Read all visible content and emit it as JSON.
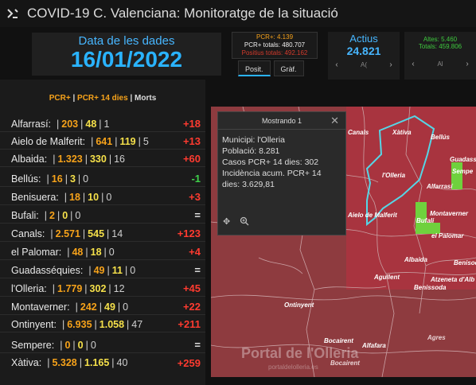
{
  "header": {
    "title": "COVID-19 C. Valenciana: Monitoratge de la situació",
    "logo_icon": "dashboard-logo-icon"
  },
  "date_box": {
    "label": "Data de les dades",
    "value": "16/01/2022"
  },
  "pcr_box": {
    "line1": "PCR+: 4.139",
    "line2": "PCR+ totals: 480.707",
    "line3": "Positius totals: 492.162"
  },
  "tabs": [
    {
      "label": "Posit.",
      "active": true
    },
    {
      "label": "Gràf.",
      "active": false
    }
  ],
  "actius": {
    "label": "Actius",
    "value": "24.821",
    "pager": "A("
  },
  "altes": {
    "line1": "Altes: 5.460",
    "line2": "Totals: 459.806",
    "pager": "Al"
  },
  "list": {
    "legend": {
      "a": "PCR+",
      "b": "PCR+ 14 dies",
      "c": "Morts",
      "sep": " | "
    },
    "rows": [
      {
        "name": "Alfarrasí:",
        "pcr": "203",
        "pcr14": "48",
        "morts": "1",
        "delta": "+18",
        "dir": "up"
      },
      {
        "name": "Aielo de Malferit:",
        "pcr": "641",
        "pcr14": "119",
        "morts": "5",
        "delta": "+13",
        "dir": "up"
      },
      {
        "name": "Albaida:",
        "pcr": "1.323",
        "pcr14": "330",
        "morts": "16",
        "delta": "+60",
        "dir": "up"
      },
      {
        "name": "Bellús:",
        "pcr": "16",
        "pcr14": "3",
        "morts": "0",
        "delta": "-1",
        "dir": "down"
      },
      {
        "name": "Benisuera:",
        "pcr": "18",
        "pcr14": "10",
        "morts": "0",
        "delta": "+3",
        "dir": "up"
      },
      {
        "name": "Bufali:",
        "pcr": "2",
        "pcr14": "0",
        "morts": "0",
        "delta": "=",
        "dir": "eq"
      },
      {
        "name": "Canals:",
        "pcr": "2.571",
        "pcr14": "545",
        "morts": "14",
        "delta": "+123",
        "dir": "up"
      },
      {
        "name": "el Palomar:",
        "pcr": "48",
        "pcr14": "18",
        "morts": "0",
        "delta": "+4",
        "dir": "up"
      },
      {
        "name": "Guadasséquies:",
        "pcr": "49",
        "pcr14": "11",
        "morts": "0",
        "delta": "=",
        "dir": "eq"
      },
      {
        "name": "l'Olleria:",
        "pcr": "1.779",
        "pcr14": "302",
        "morts": "12",
        "delta": "+45",
        "dir": "up"
      },
      {
        "name": "Montaverner:",
        "pcr": "242",
        "pcr14": "49",
        "morts": "0",
        "delta": "+22",
        "dir": "up"
      },
      {
        "name": "Ontinyent:",
        "pcr": "6.935",
        "pcr14": "1.058",
        "morts": "47",
        "delta": "+211",
        "dir": "up"
      },
      {
        "name": "Sempere:",
        "pcr": "0",
        "pcr14": "0",
        "morts": "0",
        "delta": "=",
        "dir": "eq"
      },
      {
        "name": "Xàtiva:",
        "pcr": "5.328",
        "pcr14": "1.165",
        "morts": "40",
        "delta": "+259",
        "dir": "up"
      }
    ]
  },
  "popup": {
    "title": "Mostrando 1",
    "lines": [
      "Municipi: l'Olleria",
      "Població: 8.281",
      "Casos PCR+ 14 dies: 302",
      "Incidència acum. PCR+ 14",
      "dies: 3.629,81"
    ],
    "close_icon": "close-icon",
    "tools": [
      "move-icon",
      "zoom-icon"
    ]
  },
  "map": {
    "labels": [
      {
        "text": "Canals",
        "dim": false
      },
      {
        "text": "Xàtiva",
        "dim": false
      },
      {
        "text": "Bellús",
        "dim": false
      },
      {
        "text": "Guadasséq",
        "dim": false
      },
      {
        "text": "Sempe",
        "dim": false
      },
      {
        "text": "l'Olleria",
        "dim": false
      },
      {
        "text": "Alfarrasí",
        "dim": false
      },
      {
        "text": "Montaverner",
        "dim": false
      },
      {
        "text": "Bufali",
        "dim": false
      },
      {
        "text": "el Palomar",
        "dim": false
      },
      {
        "text": "Albaida",
        "dim": false
      },
      {
        "text": "Agullent",
        "dim": false
      },
      {
        "text": "Benissoda",
        "dim": false
      },
      {
        "text": "Atzeneta d'Alb",
        "dim": false
      },
      {
        "text": "Ontinyent",
        "dim": false
      },
      {
        "text": "Bocairent",
        "dim": false
      },
      {
        "text": "Alfafara",
        "dim": false
      },
      {
        "text": "Agres",
        "dim": true
      },
      {
        "text": "Bocairent",
        "dim": true
      },
      {
        "text": "Benisoda",
        "dim": false
      },
      {
        "text": "Aielo de Malferit",
        "dim": false
      }
    ],
    "watermark": "Portal de l'Olleria",
    "watermark_sub": "portaldelolleria.es"
  },
  "colors": {
    "accent_blue": "#2ab3ff",
    "pcr_orange": "#f6a21a",
    "pcr14_yellow": "#f5e04a",
    "increase_red": "#ff3b30",
    "decrease_green": "#3fd14a",
    "map_fill": "#8e3b3f",
    "selection_cyan": "#55d6e6"
  }
}
